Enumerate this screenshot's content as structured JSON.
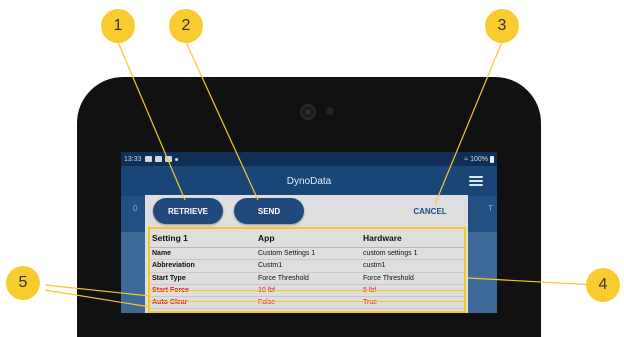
{
  "device": {
    "status_time": "13:33",
    "battery": "100%"
  },
  "app": {
    "title": "DynoData",
    "behind_left": "0",
    "behind_right": "T"
  },
  "dialog": {
    "retrieve_label": "RETRIEVE",
    "send_label": "SEND",
    "cancel_label": "CANCEL",
    "columns": [
      "Setting 1",
      "App",
      "Hardware"
    ],
    "rows": [
      {
        "name": "Name",
        "app": "Custom Settings 1",
        "hardware": "custom settings 1",
        "mismatch": false
      },
      {
        "name": "Abbreviation",
        "app": "Custm1",
        "hardware": "custm1",
        "mismatch": false
      },
      {
        "name": "Start Type",
        "app": "Force Threshold",
        "hardware": "Force Threshold",
        "mismatch": false
      },
      {
        "name": "Start Force",
        "app": "10 lbf",
        "hardware": "5 lbf",
        "mismatch": true
      },
      {
        "name": "Auto Clear",
        "app": "False",
        "hardware": "True",
        "mismatch": true
      }
    ],
    "mismatch_color": "#e31e24"
  },
  "callouts": [
    "1",
    "2",
    "3",
    "4",
    "5"
  ],
  "colors": {
    "callout": "#f8cb2e",
    "button": "#21497c",
    "appbar": "#1a4577"
  }
}
